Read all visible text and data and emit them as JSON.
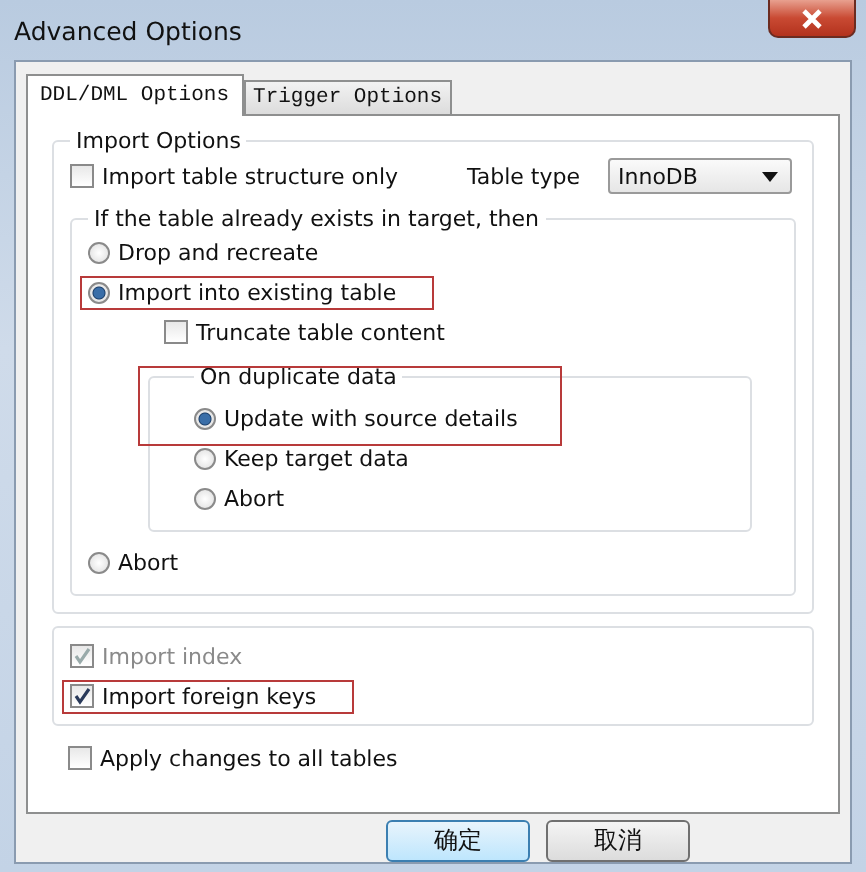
{
  "window": {
    "title": "Advanced Options"
  },
  "tabs": [
    {
      "label": "DDL/DML Options",
      "selected": true
    },
    {
      "label": "Trigger Options",
      "selected": false
    }
  ],
  "import_options": {
    "title": "Import Options",
    "structure_only": {
      "label": "Import table structure only",
      "checked": false
    },
    "table_type": {
      "label": "Table type",
      "value": "InnoDB"
    },
    "existing": {
      "title": "If the table already exists in target, then",
      "options": [
        {
          "label": "Drop and recreate",
          "selected": false,
          "highlighted": false
        },
        {
          "label": "Import into existing table",
          "selected": true,
          "highlighted": true
        },
        {
          "label": "Abort",
          "selected": false,
          "highlighted": false
        }
      ],
      "truncate": {
        "label": "Truncate table content",
        "checked": false
      },
      "duplicate": {
        "title": "On duplicate data",
        "highlighted": true,
        "options": [
          {
            "label": "Update with source details",
            "selected": true
          },
          {
            "label": "Keep target data",
            "selected": false
          },
          {
            "label": "Abort",
            "selected": false
          }
        ]
      }
    }
  },
  "extras": [
    {
      "label": "Import index",
      "checked": true,
      "disabled": true,
      "highlighted": false
    },
    {
      "label": "Import foreign keys",
      "checked": true,
      "disabled": false,
      "highlighted": true
    }
  ],
  "apply_all": {
    "label": "Apply changes to all tables",
    "checked": false
  },
  "buttons": [
    {
      "label": "确定",
      "default": true
    },
    {
      "label": "取消",
      "default": false
    }
  ]
}
